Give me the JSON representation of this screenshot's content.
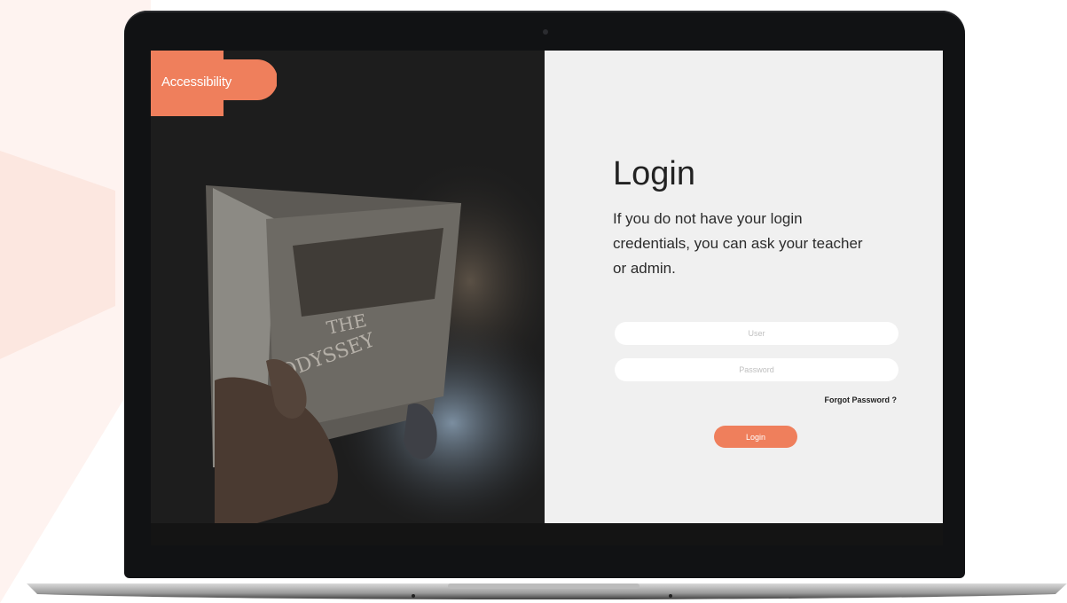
{
  "brand": {
    "badge_label": "Accessibility",
    "accent_color": "#ef7f5c"
  },
  "hero_image": {
    "book_title_line1": "THE",
    "book_title_line2": "ODYSSEY"
  },
  "login": {
    "title": "Login",
    "description": "If you do not have your login credentials, you can ask your teacher or admin.",
    "username_placeholder": "User",
    "password_placeholder": "Password",
    "forgot_label": "Forgot Password ?",
    "submit_label": "Login"
  }
}
